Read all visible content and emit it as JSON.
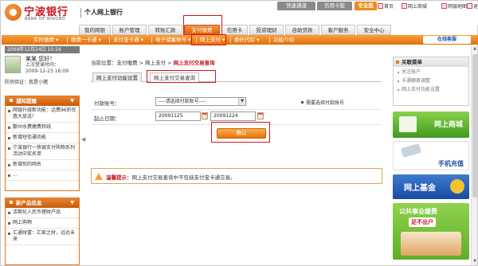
{
  "header": {
    "bank_name": "宁波银行",
    "bank_en": "BANK OF NINGBO",
    "personal_title": "个人网上银行",
    "top_tabs": {
      "quick": "快速通道",
      "credit": "信用卡版",
      "pro": "专业版"
    },
    "top_links": {
      "home": "首页",
      "mall": "网上商城",
      "map": "网银地图",
      "exit": "退出"
    }
  },
  "main_nav": [
    "我的网银",
    "账户管理",
    "转账汇款",
    "支付缴费",
    "信用卡",
    "投资理财",
    "自助贷款",
    "客户服务",
    "安全中心"
  ],
  "sub_nav": [
    "实时缴费 ▾",
    "缴费一卡通 ▾",
    "支付宝卡通 ▾",
    "电子储蓄账号 ▾",
    "网上支付 ▾",
    "委托代扣 ▾",
    "功能介绍"
  ],
  "online_service": "在线客服",
  "user": {
    "date": "2009年12月24日 10:24",
    "greeting": "某某 您好！",
    "last_login_label": "上次登录时间：",
    "last_login_time": "2009-12-23 16:09",
    "anti_phish": "防伪验证：我是小猪"
  },
  "notice": {
    "title": "通知提醒",
    "items": [
      "网银升级新功能：话费96折优惠大放送！",
      "鄞州水费缴费转线",
      "新增短信通功能",
      "宁波银行一快银支付购物系列活动中奖名单",
      "新增你的网名",
      "..."
    ]
  },
  "finance": {
    "title": "新产品信息",
    "items": [
      "活期化人民币理财产品",
      "网上购物",
      "汇通财富：汇家之财，远达未来"
    ]
  },
  "breadcrumb": {
    "prefix": "当前位置：支付缴费 > 网上支付 > ",
    "current": "网上支付交易查询"
  },
  "subtabs": {
    "settings": "网上支付功能设置",
    "query": "网上支付交易查询"
  },
  "form": {
    "account_label": "付款账号：",
    "account_placeholder": "----请选择付款账号----",
    "set_default": "需要选择付款账号",
    "date_label": "起止日期：",
    "start_date": "20091125",
    "end_date": "20091224",
    "confirm": "确认"
  },
  "tip": {
    "label": "温馨提示：",
    "text": "网上支付交易查询中不包括支付宝卡通交易。"
  },
  "related": {
    "title": "关联菜单",
    "items": [
      "关注账户",
      "卡通额度调整",
      "网上支付功能设置"
    ]
  },
  "promos": {
    "mall": "网上商城",
    "phone": "手机充值",
    "fund": "网上基金",
    "util_1": "公共事业缴费",
    "util_2": "足不出户"
  }
}
